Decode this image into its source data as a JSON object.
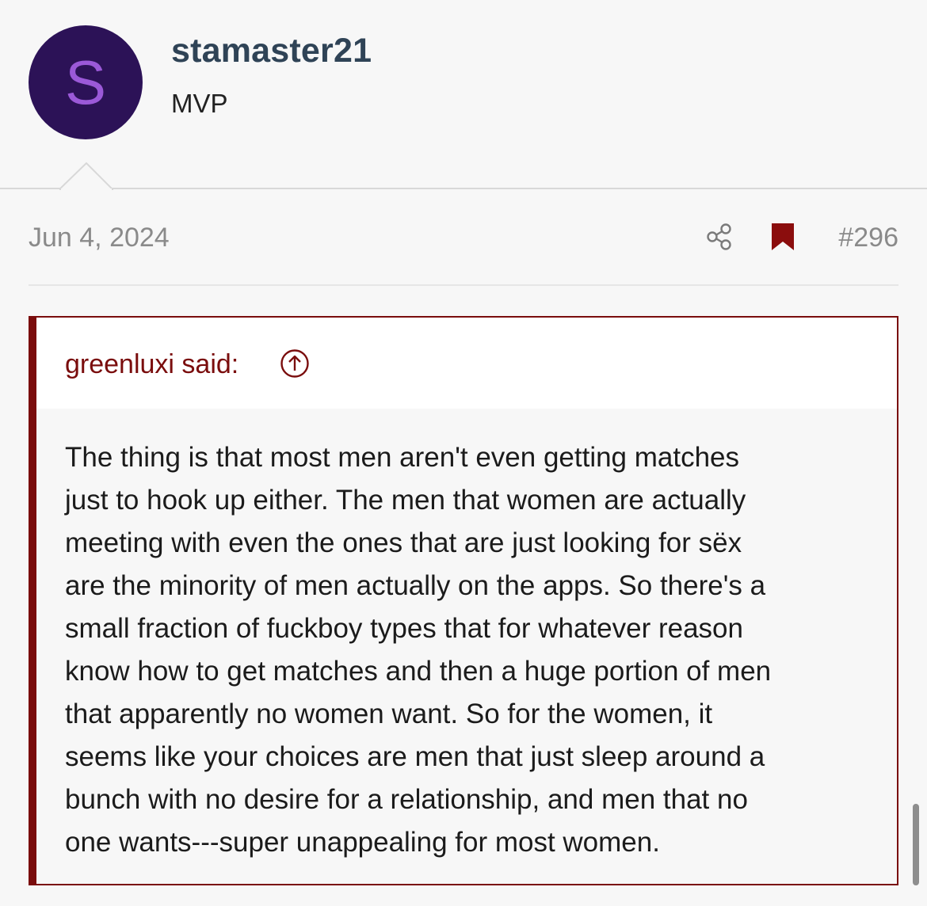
{
  "user": {
    "avatar_letter": "S",
    "username": "stamaster21",
    "title": "MVP"
  },
  "post": {
    "date": "Jun 4, 2024",
    "number": "#296",
    "icons": [
      "share-icon",
      "bookmark-icon"
    ]
  },
  "quote": {
    "author_label": "greenluxi said:",
    "jump_icon": "arrow-up-circle-icon",
    "body": "The thing is that most men aren't even getting matches\njust to hook up either. The men that women are actually\nmeeting with even the ones that are just looking for sëx\nare the minority of men actually on the apps. So there's a\nsmall fraction of fuckboy types that for whatever reason\nknow how to get matches and then a huge portion of men\nthat apparently no women want. So for the women, it\nseems like your choices are men that just sleep around a\nbunch with no desire for a relationship, and men that no\none wants---super unappealing for most women."
  },
  "colors": {
    "avatar_bg": "#2c1257",
    "avatar_letter": "#9b59d8",
    "accent": "#7a0d0d",
    "username": "#2f4356"
  }
}
